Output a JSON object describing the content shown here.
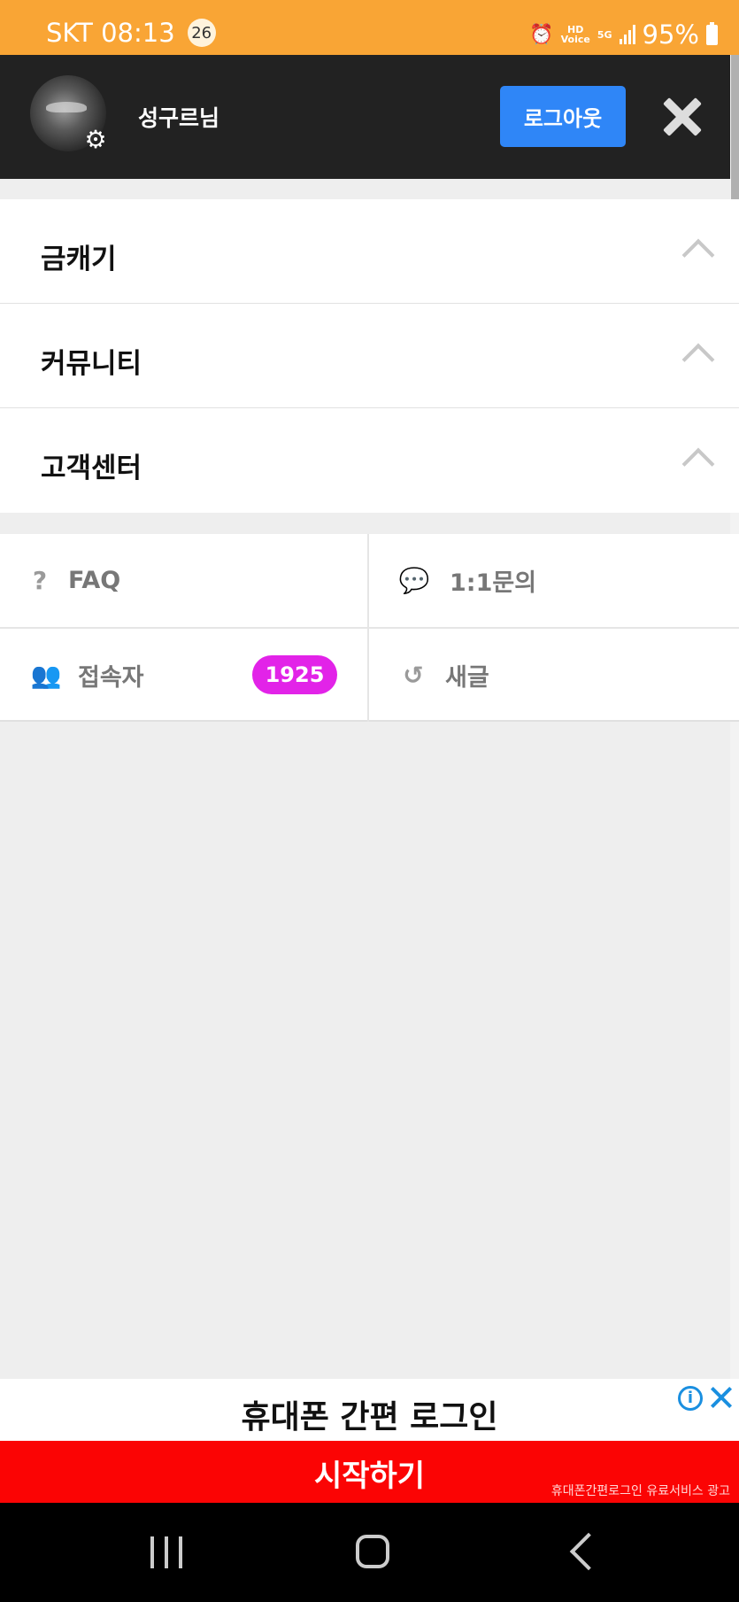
{
  "status_bar": {
    "carrier_time": "SKT 08:13",
    "notification_count": "26",
    "battery": "95%",
    "network_type": "5G",
    "hd_voice": "HD"
  },
  "header": {
    "user_name": "성구르님",
    "logout_label": "로그아웃"
  },
  "menu": {
    "items": [
      {
        "label": "금캐기"
      },
      {
        "label": "커뮤니티"
      },
      {
        "label": "고객센터"
      }
    ]
  },
  "quick_links": {
    "faq_label": "FAQ",
    "inquiry_label": "1:1문의",
    "visitors_label": "접속자",
    "visitors_count": "1925",
    "new_posts_label": "새글"
  },
  "ad": {
    "title": "휴대폰 간편 로그인",
    "cta": "시작하기",
    "disclaimer": "휴대폰간편로그인 유료서비스 광고"
  },
  "colors": {
    "status_bar": "#f9a535",
    "header_bg": "#222222",
    "logout_button": "#2f86f7",
    "count_badge": "#e223e8",
    "ad_cta_bg": "#fb0404"
  },
  "icons": [
    "alarm-icon",
    "signal-icon",
    "battery-icon",
    "gear-icon",
    "close-icon",
    "chevron-up-icon",
    "question-icon",
    "chat-icon",
    "users-icon",
    "history-icon",
    "info-icon",
    "recent-apps-icon",
    "home-icon",
    "back-icon"
  ]
}
